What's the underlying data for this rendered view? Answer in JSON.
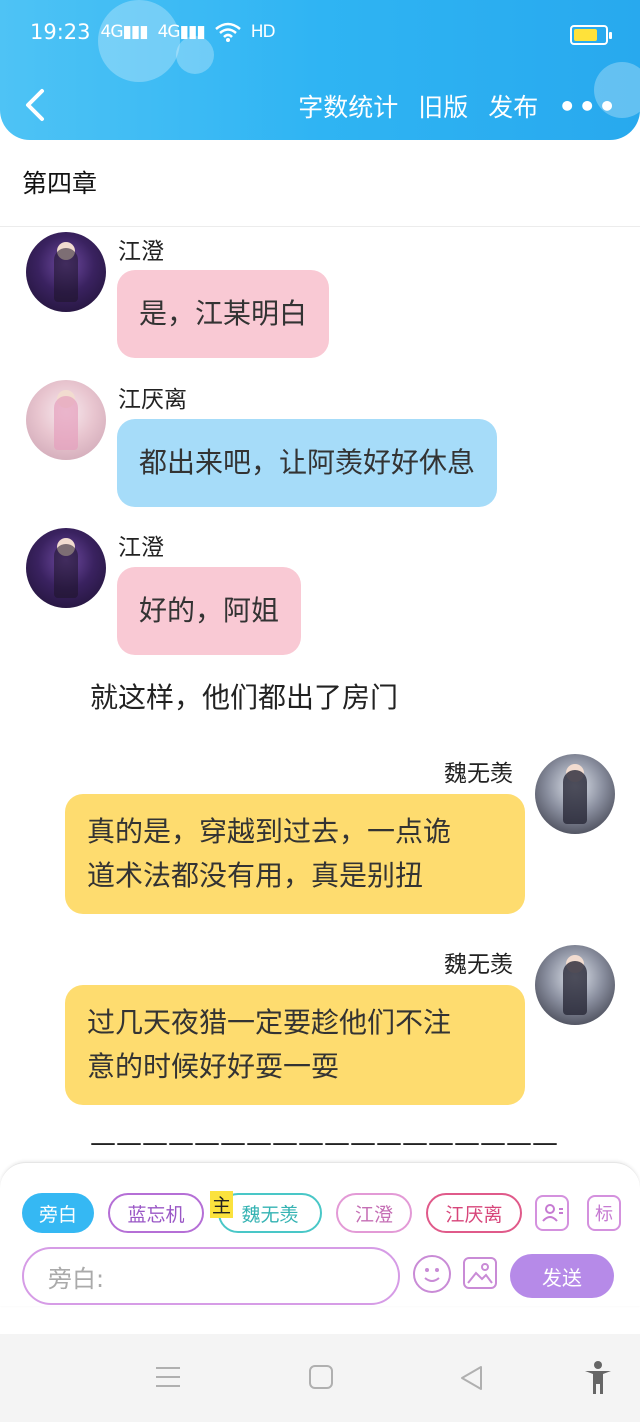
{
  "status_bar": {
    "time": "19:23",
    "signal1": "4G",
    "signal2": "4G",
    "hd": "HD",
    "battery_level": 0.75,
    "battery_color": "#ffe23a"
  },
  "header": {
    "word_count": "字数统计",
    "old_version": "旧版",
    "publish": "发布",
    "more": "•••",
    "background_color": "#2fb4f3"
  },
  "chapter_title": "第四章",
  "messages": [
    {
      "name": "江澄",
      "text": "是，江某明白",
      "side": "left",
      "color": "#f9c9d4"
    },
    {
      "name": "江厌离",
      "text": "都出来吧，让阿羡好好休息",
      "side": "left",
      "color": "#a6dcf9"
    },
    {
      "name": "江澄",
      "text": "好的，阿姐",
      "side": "left",
      "color": "#f9c9d4"
    },
    {
      "name": "魏无羡",
      "text_line1": "真的是，穿越到过去，一点诡",
      "text_line2": "道术法都没有用，真是别扭",
      "side": "right",
      "color": "#fedc6f"
    },
    {
      "name": "魏无羡",
      "text_line1": "过几天夜猎一定要趁他们不注",
      "text_line2": "意的时候好好耍一耍",
      "side": "right",
      "color": "#fedc6f"
    }
  ],
  "narration": "就这样，他们都出了房门",
  "separator": "——————————————————",
  "input_panel": {
    "chips": [
      "旁白",
      "蓝忘机",
      "魏无羡",
      "江澄",
      "江厌离"
    ],
    "main_badge": "主",
    "label_button": "标",
    "input_placeholder": "旁白:",
    "send_label": "发送"
  }
}
